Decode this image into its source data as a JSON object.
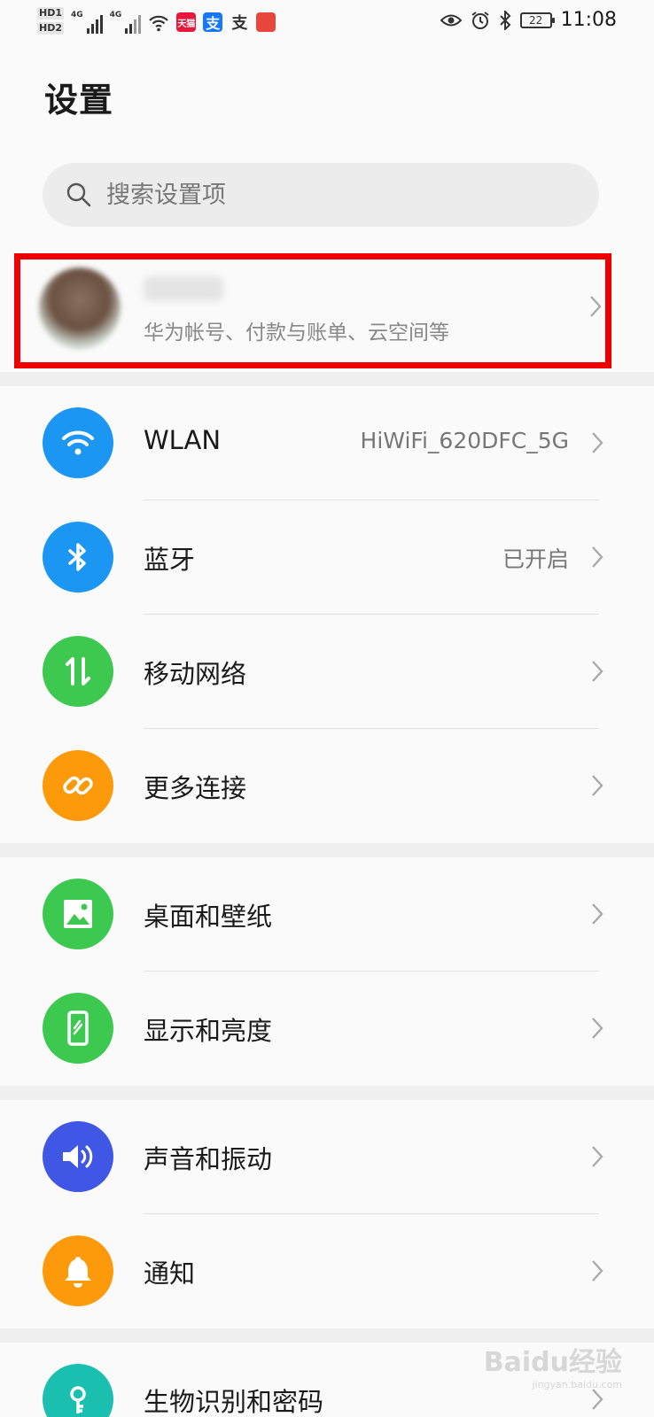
{
  "status_bar": {
    "hd1": "HD1",
    "hd2": "HD2",
    "net1": "4G",
    "net2": "4G",
    "apps": [
      {
        "name": "tmall",
        "text": "天猫",
        "color": "#e8183c"
      },
      {
        "name": "alipay",
        "text": "支",
        "color": "#1677ff"
      },
      {
        "name": "alipay-mini",
        "text": "支",
        "color": "#ffffff"
      },
      {
        "name": "huawei-mall",
        "text": "",
        "color": "#e8453c"
      }
    ],
    "battery": "22",
    "time": "11:08"
  },
  "page_title": "设置",
  "search": {
    "placeholder": "搜索设置项"
  },
  "account": {
    "subtitle": "华为帐号、付款与账单、云空间等"
  },
  "groups": [
    {
      "items": [
        {
          "name": "wlan",
          "label": "WLAN",
          "value": "HiWiFi_620DFC_5G",
          "icon": "wifi-icon",
          "color": "#1b96f3"
        },
        {
          "name": "bluetooth",
          "label": "蓝牙",
          "value": "已开启",
          "icon": "bluetooth-icon",
          "color": "#1b96f3"
        },
        {
          "name": "mobile-network",
          "label": "移动网络",
          "value": "",
          "icon": "mobile-data-icon",
          "color": "#3dc94f"
        },
        {
          "name": "more-connections",
          "label": "更多连接",
          "value": "",
          "icon": "link-icon",
          "color": "#fd9a0b"
        }
      ]
    },
    {
      "items": [
        {
          "name": "home-wallpaper",
          "label": "桌面和壁纸",
          "value": "",
          "icon": "image-icon",
          "color": "#3dc94f"
        },
        {
          "name": "display-brightness",
          "label": "显示和亮度",
          "value": "",
          "icon": "phone-display-icon",
          "color": "#3dc94f"
        }
      ]
    },
    {
      "items": [
        {
          "name": "sound-vibration",
          "label": "声音和振动",
          "value": "",
          "icon": "speaker-icon",
          "color": "#4057e6"
        },
        {
          "name": "notifications",
          "label": "通知",
          "value": "",
          "icon": "bell-icon",
          "color": "#fd9a0b"
        }
      ]
    },
    {
      "items": [
        {
          "name": "biometrics-password",
          "label": "生物识别和密码",
          "value": "",
          "icon": "key-icon",
          "color": "#1bbfb0"
        }
      ]
    }
  ],
  "watermark": {
    "text": "Baidu经验",
    "sub": "jingyan.baidu.com"
  }
}
